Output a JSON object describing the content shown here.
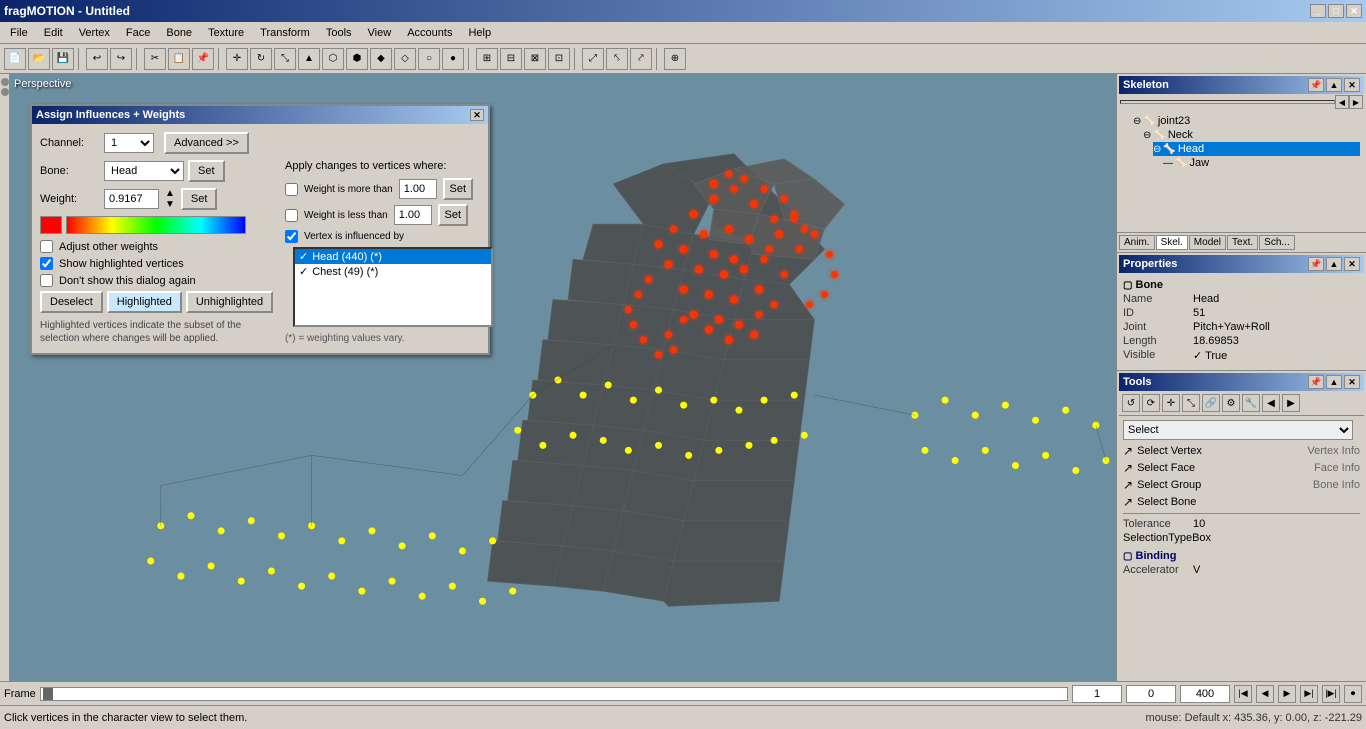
{
  "app": {
    "title": "fragMOTION - Untitled",
    "title_buttons": [
      "_",
      "□",
      "✕"
    ]
  },
  "menu": {
    "items": [
      "File",
      "Edit",
      "Vertex",
      "Face",
      "Bone",
      "Texture",
      "Transform",
      "Tools",
      "View",
      "Accounts",
      "Help"
    ]
  },
  "viewport": {
    "label": "Perspective"
  },
  "dialog": {
    "title": "Assign Influences + Weights",
    "channel_label": "Channel:",
    "channel_value": "1",
    "advanced_btn": "Advanced >>",
    "apply_label": "Apply changes to vertices where:",
    "bone_label": "Bone:",
    "bone_value": "Head",
    "set_btn": "Set",
    "weight_label": "Weight:",
    "weight_value": "0.9167",
    "set_btn2": "Set",
    "set_all_btn": "Set",
    "conditions": [
      {
        "label": "Weight is more than",
        "value": "1.00",
        "set": "Set",
        "checked": false
      },
      {
        "label": "Weight is less than",
        "value": "1.00",
        "set": "Set",
        "checked": false
      },
      {
        "label": "Vertex is influenced by",
        "checked": true
      }
    ],
    "bones": [
      {
        "label": "Head (440) (*)",
        "selected": true
      },
      {
        "label": "Chest (49) (*)",
        "selected": false
      }
    ],
    "checkboxes": [
      {
        "label": "Adjust other weights",
        "checked": false
      },
      {
        "label": "Show highlighted vertices",
        "checked": true
      },
      {
        "label": "Don't show this dialog again",
        "checked": false
      }
    ],
    "deselect_btn": "Deselect",
    "highlighted_btn": "Highlighted",
    "unhighlighted_btn": "Unhighlighted",
    "info_text": "Highlighted vertices indicate the subset of the selection where changes will be applied.",
    "footnote": "(*) = weighting values vary."
  },
  "skeleton": {
    "panel_title": "Skeleton",
    "tree": [
      {
        "label": "joint23",
        "indent": 1
      },
      {
        "label": "Neck",
        "indent": 2
      },
      {
        "label": "Head",
        "indent": 3,
        "selected": true
      },
      {
        "label": "Jaw",
        "indent": 4
      }
    ]
  },
  "properties": {
    "panel_title": "Properties",
    "section": "Bone",
    "rows": [
      {
        "name": "Name",
        "value": "Head"
      },
      {
        "name": "ID",
        "value": "51"
      },
      {
        "name": "Joint",
        "value": "Pitch+Yaw+Roll"
      },
      {
        "name": "Length",
        "value": "18.69853"
      },
      {
        "name": "Visible",
        "value": "✓ True"
      }
    ]
  },
  "panel_tabs": {
    "anim": "Anim.",
    "skel": "Skel.",
    "model": "Model",
    "text": "Text.",
    "sch": "Sch..."
  },
  "tools": {
    "panel_title": "Tools",
    "select_label": "Select",
    "items": [
      {
        "label": "Select Vertex",
        "info": "Vertex Info",
        "icon": "↗"
      },
      {
        "label": "Select Face",
        "info": "Face Info",
        "icon": "↗"
      },
      {
        "label": "Select Group",
        "info": "Bone Info",
        "icon": "↗"
      },
      {
        "label": "Select Bone",
        "icon": "↗"
      }
    ],
    "tolerance_label": "Tolerance",
    "tolerance_value": "10",
    "selection_type": "SelectionTypeBox",
    "binding_section": "Binding",
    "accelerator_label": "Accelerator",
    "accelerator_value": "V"
  },
  "timeline": {
    "frame_label": "Frame",
    "start": "1",
    "current": "0",
    "end": "400"
  },
  "status": {
    "left": "Click vertices in the character view to select them.",
    "right": "mouse: Default     x: 435.36, y: 0.00, z: -221.29"
  }
}
